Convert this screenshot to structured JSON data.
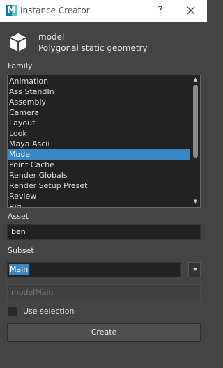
{
  "window": {
    "title": "Instance Creator",
    "help": "?"
  },
  "header": {
    "name": "model",
    "description": "Polygonal static geometry"
  },
  "family": {
    "label": "Family",
    "items": [
      "Animation",
      "Ass StandIn",
      "Assembly",
      "Camera",
      "Layout",
      "Look",
      "Maya Ascii",
      "Model",
      "Point Cache",
      "Render Globals",
      "Render Setup Preset",
      "Review",
      "Rig"
    ],
    "selected": "Model"
  },
  "asset": {
    "label": "Asset",
    "value": "ben"
  },
  "subset": {
    "label": "Subset",
    "value": "Main"
  },
  "result": {
    "value": "modelMain"
  },
  "options": {
    "use_selection_label": "Use selection",
    "use_selection_checked": false
  },
  "actions": {
    "create_label": "Create"
  },
  "colors": {
    "selection": "#3a87c6",
    "background": "#444444",
    "list_bg": "#222222"
  }
}
